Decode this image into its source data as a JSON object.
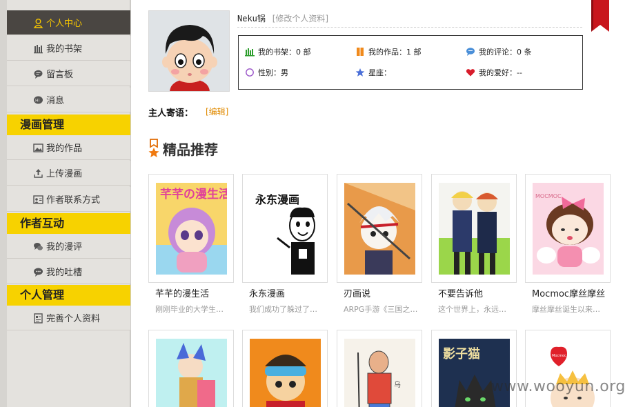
{
  "sidebar": {
    "items": [
      {
        "label": "个人中心",
        "icon": "user-icon",
        "active": true
      },
      {
        "label": "我的书架",
        "icon": "bookshelf-icon"
      },
      {
        "label": "留言板",
        "icon": "message-board-icon"
      },
      {
        "label": "消息",
        "icon": "message-icon"
      }
    ],
    "section_manga": "漫画管理",
    "manga_items": [
      {
        "label": "我的作品",
        "icon": "works-icon"
      },
      {
        "label": "上传漫画",
        "icon": "upload-icon"
      },
      {
        "label": "作者联系方式",
        "icon": "contact-card-icon"
      }
    ],
    "section_interact": "作者互动",
    "interact_items": [
      {
        "label": "我的漫评",
        "icon": "comment-icon"
      },
      {
        "label": "我的吐槽",
        "icon": "chat-icon"
      }
    ],
    "section_personal": "个人管理",
    "personal_items": [
      {
        "label": "完善个人资料",
        "icon": "profile-icon"
      }
    ]
  },
  "profile": {
    "username": "Neku锅",
    "edit_profile": "[修改个人资料]",
    "stats": {
      "bookshelf": "我的书架：0 部",
      "works": "我的作品：1 部",
      "comments": "我的评论：0 条",
      "gender": "性别：男",
      "constellation": "星座：",
      "hobby": "我的爱好：--"
    },
    "motto_label": "主人寄语：",
    "motto_edit": "[编辑]"
  },
  "recommend": {
    "title": "精品推荐",
    "cards": [
      {
        "title": "芊芊的漫生活",
        "desc": "刚刚毕业的大学生…"
      },
      {
        "title": "永东漫画",
        "desc": "我们成功了躲过了…"
      },
      {
        "title": "刃画说",
        "desc": "ARPG手游《三国之…"
      },
      {
        "title": "不要告诉他",
        "desc": "这个世界上，永远…"
      },
      {
        "title": "Mocmoc摩丝摩丝",
        "desc": "摩丝摩丝诞生以来…"
      }
    ],
    "cover_texts": {
      "c1": "芊芊の漫生活",
      "c2": "永东漫画",
      "c4": "MOCMOC",
      "r2_4": "影子猫",
      "r2_5": "Mocmoc"
    }
  },
  "watermark": "www.wooyun.org",
  "colors": {
    "sidebar_active_bg": "#4a4642",
    "sidebar_active_text": "#f6c500",
    "section_bg": "#f7d200",
    "ribbon": "#c8161d",
    "link_orange": "#e08a00"
  }
}
